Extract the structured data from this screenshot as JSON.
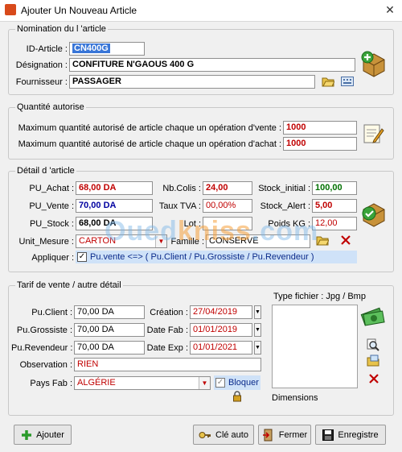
{
  "window": {
    "title": "Ajouter Un Nouveau Article",
    "close": "✕"
  },
  "nomination": {
    "legend": "Nomination du l 'article",
    "id_label": "ID-Article :",
    "id_value": "CN400G",
    "designation_label": "Désignation :",
    "designation_value": "CONFITURE N'GAOUS 400 G",
    "fournisseur_label": "Fournisseur :",
    "fournisseur_value": "PASSAGER"
  },
  "quantite": {
    "legend": "Quantité autorise",
    "vente_label": "Maximum quantité autorisé de article chaque un opération d'vente :",
    "vente_value": "1000",
    "achat_label": "Maximum quantité autorisé de article chaque un opération d'achat :",
    "achat_value": "1000"
  },
  "detail": {
    "legend": "Détail d 'article",
    "pu_achat_label": "PU_Achat :",
    "pu_achat_value": "68,00 DA",
    "pu_vente_label": "PU_Vente :",
    "pu_vente_value": "70,00 DA",
    "pu_stock_label": "PU_Stock :",
    "pu_stock_value": "68,00 DA",
    "nb_colis_label": "Nb.Colis :",
    "nb_colis_value": "24,00",
    "taux_tva_label": "Taux TVA :",
    "taux_tva_value": "00,00%",
    "lot_label": "Lot :",
    "lot_value": "",
    "stock_initial_label": "Stock_initial :",
    "stock_initial_value": "100,00",
    "stock_alert_label": "Stock_Alert :",
    "stock_alert_value": "5,00",
    "poids_label": "Poids KG :",
    "poids_value": "12,00",
    "unit_label": "Unit_Mesure :",
    "unit_value": "CARTON",
    "famille_label": "Famille :",
    "famille_value": "CONSERVE",
    "appliquer_label": "Appliquer :",
    "appliquer_text": "Pu.vente <=> ( Pu.Client / Pu.Grossiste / Pu.Revendeur )"
  },
  "tarif": {
    "legend": "Tarif de vente / autre détail",
    "client_label": "Pu.Client :",
    "client_value": "70,00 DA",
    "grossiste_label": "Pu.Grossiste :",
    "grossiste_value": "70,00 DA",
    "revendeur_label": "Pu.Revendeur :",
    "revendeur_value": "70,00 DA",
    "creation_label": "Création :",
    "creation_value": "27/04/2019",
    "datefab_label": "Date Fab :",
    "datefab_value": "01/01/2019",
    "dateexp_label": "Date Exp :",
    "dateexp_value": "01/01/2021",
    "observation_label": "Observation :",
    "observation_value": "RIEN",
    "pays_label": "Pays Fab :",
    "pays_value": "ALGÉRIE",
    "bloquer_label": "Bloquer",
    "type_fichier_label": "Type fichier : Jpg / Bmp",
    "dimensions_label": "Dimensions"
  },
  "watermark": {
    "part1": "Oued",
    "part2": "kniss",
    "part3": ".com"
  },
  "buttons": {
    "ajouter": "Ajouter",
    "cle_auto": "Clé auto",
    "fermer": "Fermer",
    "enregistrer": "Enregistre"
  },
  "colors": {
    "red_value": "#c00000",
    "blue_value": "#0000a0",
    "green_value": "#007000",
    "selection": "#3875d7"
  }
}
